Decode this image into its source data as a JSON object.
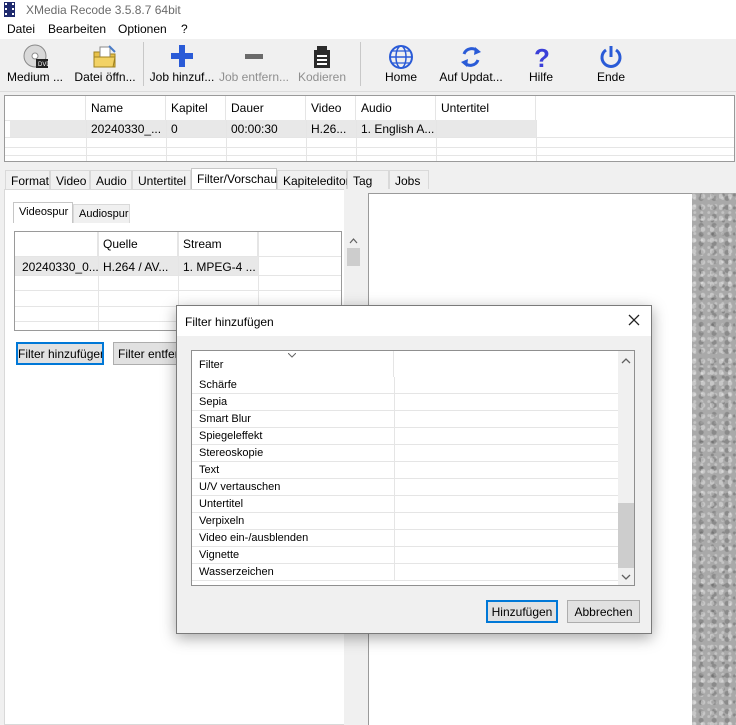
{
  "window": {
    "title": "XMedia Recode 3.5.8.7 64bit"
  },
  "menu": [
    "Datei",
    "Bearbeiten",
    "Optionen",
    "?"
  ],
  "toolbar": [
    {
      "label": "Medium ...",
      "icon": "disc-icon",
      "enabled": true
    },
    {
      "label": "Datei öffn...",
      "icon": "open-folder-icon",
      "enabled": true
    },
    {
      "label": "Job hinzuf...",
      "icon": "add-job-icon",
      "enabled": true
    },
    {
      "label": "Job entfern...",
      "icon": "remove-job-icon",
      "enabled": false
    },
    {
      "label": "Kodieren",
      "icon": "encode-icon",
      "enabled": false
    },
    {
      "label": "Home",
      "icon": "globe-icon",
      "enabled": true
    },
    {
      "label": "Auf Updat...",
      "icon": "update-icon",
      "enabled": true
    },
    {
      "label": "Hilfe",
      "icon": "help-icon",
      "enabled": true
    },
    {
      "label": "Ende",
      "icon": "power-icon",
      "enabled": true
    }
  ],
  "job_list": {
    "columns": [
      "Name",
      "Kapitel",
      "Dauer",
      "Video",
      "Audio",
      "Untertitel"
    ],
    "rows": [
      [
        "20240330_...",
        "0",
        "00:00:30",
        "H.26...",
        "1. English A...",
        ""
      ]
    ]
  },
  "tabs": [
    "Format",
    "Video",
    "Audio",
    "Untertitel",
    "Filter/Vorschau",
    "Kapiteleditor",
    "Tag",
    "Jobs"
  ],
  "active_tab": "Filter/Vorschau",
  "sub_tabs": [
    "Videospur",
    "Audiospur"
  ],
  "stream_list": {
    "columns": [
      "",
      "Quelle",
      "Stream"
    ],
    "rows": [
      [
        "20240330_0...",
        "H.264 / AV...",
        "1. MPEG-4 ..."
      ]
    ]
  },
  "buttons": {
    "add_filter": "Filter hinzufügen",
    "remove_filter": "Filter entfern"
  },
  "dialog": {
    "title": "Filter hinzufügen",
    "column_header": "Filter",
    "filters": [
      "Schärfe",
      "Sepia",
      "Smart Blur",
      "Spiegeleffekt",
      "Stereoskopie",
      "Text",
      "U/V vertauschen",
      "Untertitel",
      "Verpixeln",
      "Video ein-/ausblenden",
      "Vignette",
      "Wasserzeichen"
    ],
    "ok_label": "Hinzufügen",
    "cancel_label": "Abbrechen"
  },
  "colors": {
    "accent": "#0078d7",
    "add_icon": "#2a5bd7",
    "help_icon": "#3a3fd8"
  }
}
